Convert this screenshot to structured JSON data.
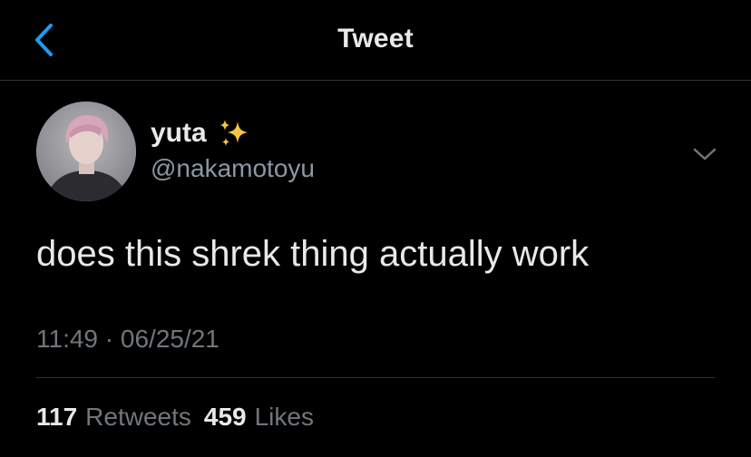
{
  "header": {
    "title": "Tweet"
  },
  "tweet": {
    "display_name": "yuta",
    "name_emoji": "sparkles-icon",
    "handle": "@nakamotoyu",
    "text": "does this shrek thing actually work",
    "time": "11:49",
    "separator": "·",
    "date": "06/25/21",
    "retweets_count": "117",
    "retweets_label": "Retweets",
    "likes_count": "459",
    "likes_label": "Likes"
  },
  "colors": {
    "background": "#000000",
    "accent": "#1d9bf0",
    "primary_text": "#e7e9ea",
    "secondary_text": "#71767b",
    "divider": "#2f3336"
  }
}
